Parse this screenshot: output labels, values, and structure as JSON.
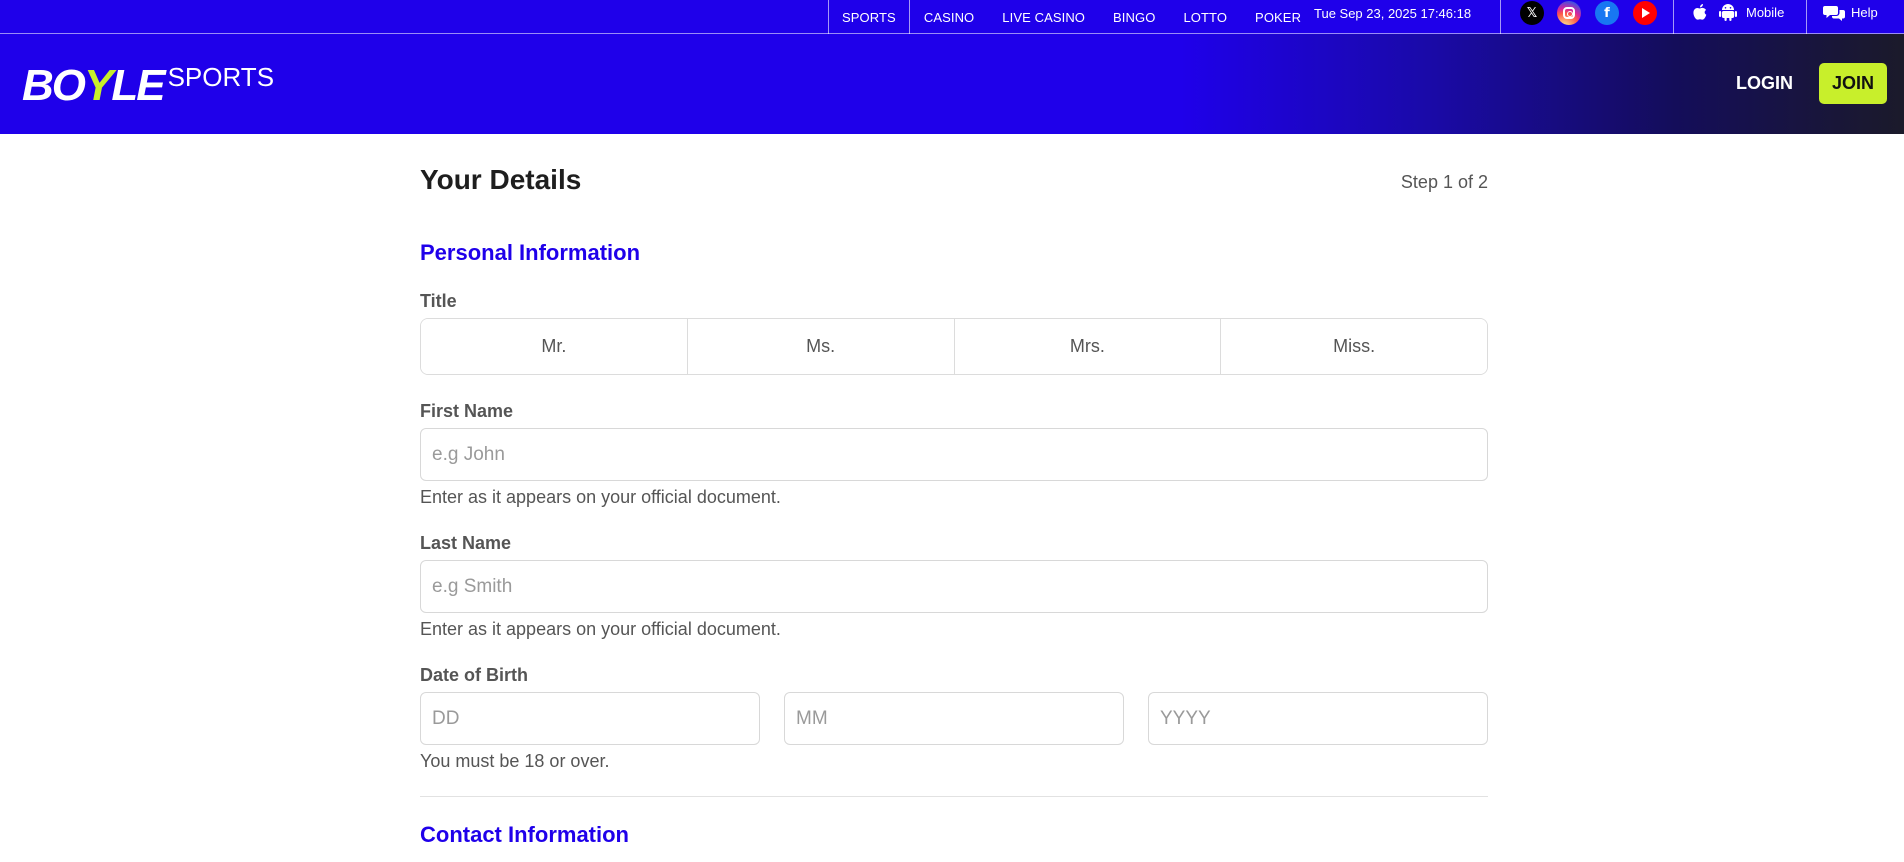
{
  "topbar": {
    "nav": [
      "SPORTS",
      "CASINO",
      "LIVE CASINO",
      "BINGO",
      "LOTTO",
      "POKER"
    ],
    "datetime": "Tue Sep 23, 2025 17:46:18",
    "social": {
      "x": "𝕏",
      "facebook": "f"
    },
    "mobile_label": "Mobile",
    "help_label": "Help"
  },
  "header": {
    "logo": {
      "part1": "BO",
      "part2": "Y",
      "part3": "LE",
      "sub": "SPORTS"
    },
    "login_label": "LOGIN",
    "join_label": "JOIN",
    "join_color": "#c8ef2b",
    "brand_color": "#1f00ea"
  },
  "form": {
    "title": "Your Details",
    "step": "Step 1 of 2",
    "personal_section": "Personal Information",
    "title_label": "Title",
    "title_options": [
      "Mr.",
      "Ms.",
      "Mrs.",
      "Miss."
    ],
    "first_name": {
      "label": "First Name",
      "placeholder": "e.g John",
      "hint": "Enter as it appears on your official document."
    },
    "last_name": {
      "label": "Last Name",
      "placeholder": "e.g Smith",
      "hint": "Enter as it appears on your official document."
    },
    "dob": {
      "label": "Date of Birth",
      "dd": "DD",
      "mm": "MM",
      "yyyy": "YYYY",
      "hint": "You must be 18 or over."
    },
    "contact_section": "Contact Information"
  }
}
